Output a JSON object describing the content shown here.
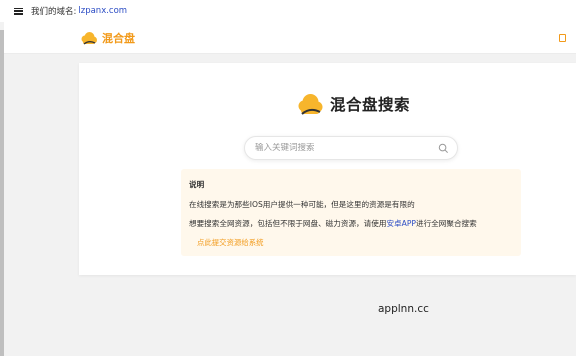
{
  "domain_bar": {
    "label": "我们的域名:",
    "domain": "lzpanx.com"
  },
  "header": {
    "brand": "混合盘"
  },
  "hero": {
    "title": "混合盘搜索"
  },
  "search": {
    "placeholder": "输入关键词搜索",
    "value": ""
  },
  "notice": {
    "title": "说明",
    "line1": "在线搜索是为那些IOS用户提供一种可能，但是这里的资源是有限的",
    "line2_prefix": "想要搜索全网资源，包括但不限于网盘、磁力资源，请使用",
    "line2_link": "安卓APP",
    "line2_suffix": "进行全网聚合搜索",
    "submit_link": "点此提交资源给系统"
  },
  "footer": {
    "text": "applnn.cc"
  },
  "colors": {
    "brand_orange": "#f29a1a",
    "cloud_yellow": "#f7b52c",
    "link_blue": "#2b4cc4",
    "notice_bg": "#fff8ec"
  }
}
